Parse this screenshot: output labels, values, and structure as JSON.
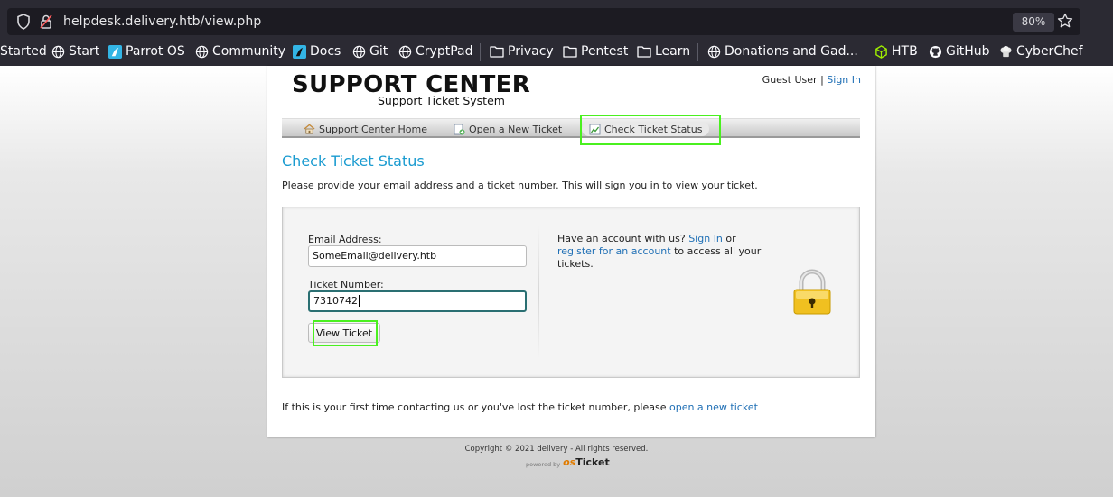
{
  "browser": {
    "url": "helpdesk.delivery.htb/view.php",
    "zoom": "80%",
    "bookmarks": [
      "Started",
      "Start",
      "Parrot OS",
      "Community",
      "Docs",
      "Git",
      "CryptPad",
      "Privacy",
      "Pentest",
      "Learn",
      "Donations and Gad...",
      "HTB",
      "GitHub",
      "CyberChef"
    ]
  },
  "header": {
    "title": "SUPPORT CENTER",
    "subtitle": "Support Ticket System",
    "guest_label": "Guest User",
    "separator": "|",
    "sign_in": "Sign In"
  },
  "nav": {
    "items": [
      "Support Center Home",
      "Open a New Ticket",
      "Check Ticket Status"
    ],
    "active": "Check Ticket Status"
  },
  "main": {
    "title": "Check Ticket Status",
    "intro": "Please provide your email address and a ticket number. This will sign you in to view your ticket.",
    "email_label": "Email Address:",
    "email_value": "SomeEmail@delivery.htb",
    "ticket_label": "Ticket Number:",
    "ticket_value": "7310742",
    "view_button": "View Ticket",
    "side_prefix": "Have an account with us?",
    "side_signin": "Sign In",
    "side_or": "or",
    "side_register": "register for an account",
    "side_suffix": "to access all your tickets.",
    "bottom_note": "If this is your first time contacting us or you've lost the ticket number, please",
    "bottom_link": "open a new ticket"
  },
  "footer": {
    "copyright": "Copyright © 2021 delivery - All rights reserved.",
    "powered_by": "powered by",
    "brand_prefix": "os",
    "brand_suffix": "Ticket"
  },
  "colors": {
    "highlight": "#4af01f",
    "link": "#1f6fb5",
    "title": "#1a9bd0"
  }
}
